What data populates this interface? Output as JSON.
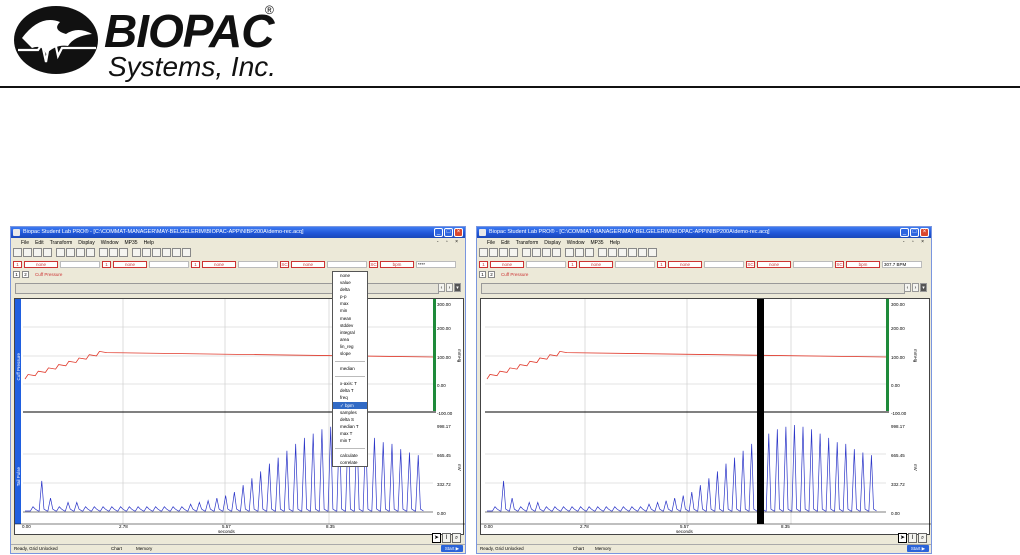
{
  "logo": {
    "line1": "BIOPAC",
    "registered": "®",
    "line2": "Systems, Inc."
  },
  "window_left": {
    "title": "Biopac Student Lab PRO® - [C:\\COMMAT-MANAGER\\MAY-BELGELERIM\\BIOPAC-APP\\NIBP200A\\demo-rec.acq]",
    "menu": [
      "File",
      "Edit",
      "Transform",
      "Display",
      "Window",
      "MP35",
      "Help"
    ],
    "measurements": [
      {
        "channel": "1",
        "type": "none",
        "value": ""
      },
      {
        "channel": "1",
        "type": "none",
        "value": ""
      },
      {
        "channel": "1",
        "type": "none",
        "value": ""
      },
      {
        "channel": "SC",
        "type": "none",
        "value": ""
      },
      {
        "channel": "SC",
        "type": "bpm",
        "value": "****"
      }
    ],
    "tabs": [
      "1",
      "2"
    ],
    "channel_label": "Cuff Pressure",
    "upper_ticks": [
      "300.00",
      "200.00",
      "100.00",
      "0.00",
      "-100.00"
    ],
    "upper_unit": "mmHg",
    "upper_label": "Cuff Pressure",
    "lower_ticks": [
      "998.17",
      "665.45",
      "332.72",
      "0.00"
    ],
    "lower_unit": "mV",
    "lower_label": "Tail Pulse",
    "x_ticks": [
      "0.00",
      "2.78",
      "5.57",
      "8.35"
    ],
    "x_label": "seconds",
    "status": "Ready, Grid Unlocked",
    "status_chart": "Chart",
    "status_memory": "Memory",
    "start": "Start",
    "dropdown": {
      "group1": [
        "none",
        "value",
        "delta",
        "p-p",
        "max",
        "min",
        "mean",
        "stddev",
        "integral",
        "area",
        "lin_reg",
        "slope"
      ],
      "group2": [
        "median"
      ],
      "group3": [
        "x-axis: T",
        "delta T",
        "freq",
        "bpm",
        "samples",
        "delta S",
        "median T",
        "max T",
        "min T"
      ],
      "group4": [
        "calculate",
        "correlate"
      ],
      "selected": "bpm"
    }
  },
  "window_right": {
    "title": "Biopac Student Lab PRO® - [C:\\COMMAT-MANAGER\\MAY-BELGELERIM\\BIOPAC-APP\\NIBP200A\\demo-rec.acq]",
    "menu": [
      "File",
      "Edit",
      "Transform",
      "Display",
      "Window",
      "MP35",
      "Help"
    ],
    "measurements": [
      {
        "channel": "1",
        "type": "none",
        "value": ""
      },
      {
        "channel": "1",
        "type": "none",
        "value": ""
      },
      {
        "channel": "1",
        "type": "none",
        "value": ""
      },
      {
        "channel": "SC",
        "type": "none",
        "value": ""
      },
      {
        "channel": "SC",
        "type": "bpm",
        "value": "307.7 BPM"
      }
    ],
    "tabs": [
      "1",
      "2"
    ],
    "channel_label": "Cuff Pressure",
    "upper_ticks": [
      "300.00",
      "200.00",
      "100.00",
      "0.00",
      "-100.00"
    ],
    "upper_unit": "mmHg",
    "lower_ticks": [
      "998.17",
      "665.45",
      "332.72",
      "0.00"
    ],
    "lower_unit": "mV",
    "x_ticks": [
      "0.00",
      "2.78",
      "5.57",
      "8.35"
    ],
    "x_label": "seconds",
    "status": "Ready, Grid Unlocked",
    "status_chart": "Chart",
    "status_memory": "Memory",
    "start": "Start"
  },
  "colors": {
    "pressure_trace": "#e0392b",
    "pulse_trace": "#2b35c8",
    "title_bar": "#2456d8",
    "selection": "#000000"
  }
}
